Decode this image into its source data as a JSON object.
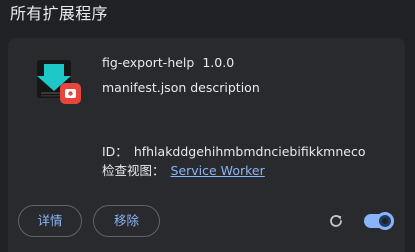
{
  "page": {
    "section_title": "所有扩展程序"
  },
  "extension": {
    "name": "fig-export-help",
    "version": "1.0.0",
    "description": "manifest.json description",
    "id_label": "ID：",
    "id_value": "hfhlakddgehihmbmdnciebifikkmneco",
    "inspect_label": "检查视图：",
    "inspect_link": "Service Worker",
    "icon": "download-arrow-icon",
    "badge_icon": "record-badge-icon",
    "enabled": true
  },
  "actions": {
    "details_label": "详情",
    "remove_label": "移除",
    "reload_icon": "reload-icon"
  },
  "colors": {
    "background": "#202124",
    "card": "#292a2d",
    "accent": "#8ab4f8",
    "badge": "#e8453c",
    "icon_teal": "#1fc8c8"
  }
}
